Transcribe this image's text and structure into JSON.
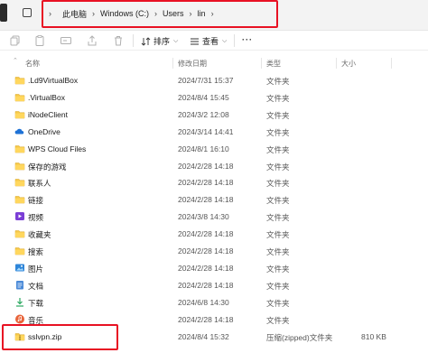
{
  "address": {
    "crumbs": [
      "此电脑",
      "Windows (C:)",
      "Users",
      "lin"
    ]
  },
  "toolbar": {
    "sort_label": "排序",
    "view_label": "查看",
    "more_label": "···"
  },
  "columns": {
    "name": "名称",
    "date": "修改日期",
    "type": "类型",
    "size": "大小"
  },
  "files": [
    {
      "name": ".Ld9VirtualBox",
      "date": "2024/7/31 15:37",
      "type": "文件夹",
      "size": "",
      "icon": "folder-icon"
    },
    {
      "name": ".VirtualBox",
      "date": "2024/8/4 15:45",
      "type": "文件夹",
      "size": "",
      "icon": "folder-icon"
    },
    {
      "name": "iNodeClient",
      "date": "2024/3/2 12:08",
      "type": "文件夹",
      "size": "",
      "icon": "folder-icon"
    },
    {
      "name": "OneDrive",
      "date": "2024/3/14 14:41",
      "type": "文件夹",
      "size": "",
      "icon": "onedrive-icon"
    },
    {
      "name": "WPS Cloud Files",
      "date": "2024/8/1 16:10",
      "type": "文件夹",
      "size": "",
      "icon": "folder-icon"
    },
    {
      "name": "保存的游戏",
      "date": "2024/2/28 14:18",
      "type": "文件夹",
      "size": "",
      "icon": "folder-icon"
    },
    {
      "name": "联系人",
      "date": "2024/2/28 14:18",
      "type": "文件夹",
      "size": "",
      "icon": "folder-icon"
    },
    {
      "name": "链接",
      "date": "2024/2/28 14:18",
      "type": "文件夹",
      "size": "",
      "icon": "folder-icon"
    },
    {
      "name": "视频",
      "date": "2024/3/8 14:30",
      "type": "文件夹",
      "size": "",
      "icon": "video-icon"
    },
    {
      "name": "收藏夹",
      "date": "2024/2/28 14:18",
      "type": "文件夹",
      "size": "",
      "icon": "folder-icon"
    },
    {
      "name": "搜索",
      "date": "2024/2/28 14:18",
      "type": "文件夹",
      "size": "",
      "icon": "folder-icon"
    },
    {
      "name": "图片",
      "date": "2024/2/28 14:18",
      "type": "文件夹",
      "size": "",
      "icon": "pictures-icon"
    },
    {
      "name": "文档",
      "date": "2024/2/28 14:18",
      "type": "文件夹",
      "size": "",
      "icon": "documents-icon"
    },
    {
      "name": "下载",
      "date": "2024/6/8 14:30",
      "type": "文件夹",
      "size": "",
      "icon": "downloads-icon"
    },
    {
      "name": "音乐",
      "date": "2024/2/28 14:18",
      "type": "文件夹",
      "size": "",
      "icon": "music-icon"
    },
    {
      "name": "sslvpn.zip",
      "date": "2024/8/4 15:32",
      "type": "压缩(zipped)文件夹",
      "size": "810 KB",
      "icon": "zip-icon"
    }
  ]
}
